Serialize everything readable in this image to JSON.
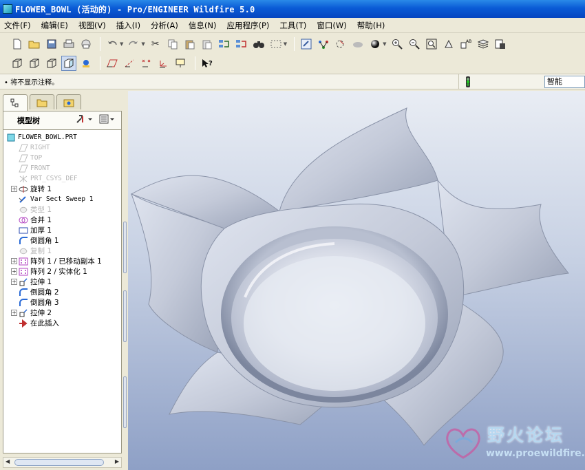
{
  "window": {
    "title": "FLOWER_BOWL (活动的) - Pro/ENGINEER Wildfire 5.0"
  },
  "menu": [
    "文件(F)",
    "编辑(E)",
    "视图(V)",
    "插入(I)",
    "分析(A)",
    "信息(N)",
    "应用程序(P)",
    "工具(T)",
    "窗口(W)",
    "帮助(H)"
  ],
  "status": {
    "message": "• 将不显示注释。",
    "filter_value": "智能"
  },
  "model_tree": {
    "header_label": "模型树",
    "items": [
      {
        "label": "FLOWER_BOWL.PRT",
        "icon": "part-icon",
        "kind": "root"
      },
      {
        "label": "RIGHT",
        "icon": "datum-plane-icon",
        "dim": true
      },
      {
        "label": "TOP",
        "icon": "datum-plane-icon",
        "dim": true
      },
      {
        "label": "FRONT",
        "icon": "datum-plane-icon",
        "dim": true
      },
      {
        "label": "PRT_CSYS_DEF",
        "icon": "csys-icon",
        "dim": true
      },
      {
        "label": "旋转 1",
        "icon": "revolve-icon",
        "expandable": true
      },
      {
        "label": "Var Sect Sweep 1",
        "icon": "sweep-icon"
      },
      {
        "label": "类型 1",
        "icon": "type-icon",
        "dim": true
      },
      {
        "label": "合并 1",
        "icon": "merge-icon"
      },
      {
        "label": "加厚 1",
        "icon": "thicken-icon"
      },
      {
        "label": "倒圆角 1",
        "icon": "round-icon"
      },
      {
        "label": "复制 1",
        "icon": "copy-icon",
        "dim": true
      },
      {
        "label": "阵列 1 / 已移动副本 1",
        "icon": "pattern-icon",
        "expandable": true
      },
      {
        "label": "阵列 2 / 实体化 1",
        "icon": "pattern-icon",
        "expandable": true
      },
      {
        "label": "拉伸 1",
        "icon": "extrude-icon",
        "expandable": true
      },
      {
        "label": "倒圆角 2",
        "icon": "round-icon"
      },
      {
        "label": "倒圆角 3",
        "icon": "round-icon"
      },
      {
        "label": "拉伸 2",
        "icon": "extrude-icon",
        "expandable": true
      },
      {
        "label": "在此插入",
        "icon": "insert-here-icon"
      }
    ]
  },
  "watermark": {
    "text": "野火论坛",
    "url": "www.proewildfire.cn"
  },
  "colors": {
    "titlebar": "#0a5bd6",
    "viewport_top": "#e9edf4",
    "viewport_bottom": "#8ea0c6",
    "accent_pattern": "#b040c0"
  }
}
